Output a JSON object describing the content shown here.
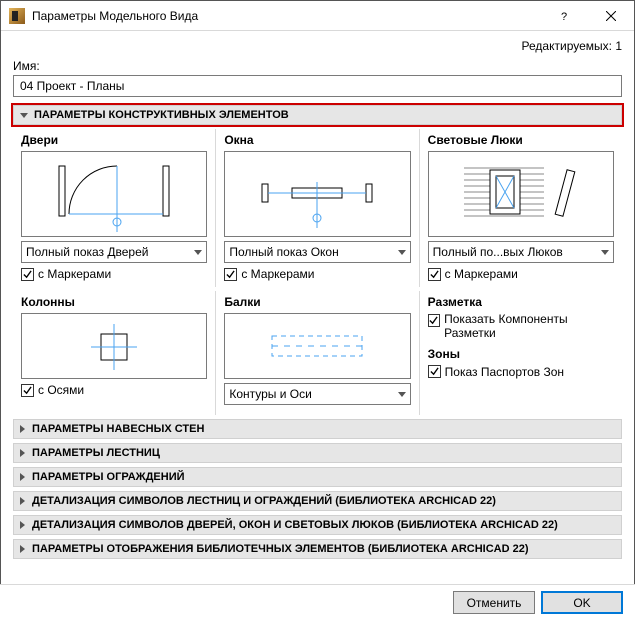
{
  "window": {
    "title": "Параметры Модельного Вида"
  },
  "editable_label": "Редактируемых: 1",
  "name_label": "Имя:",
  "name_value": "04 Проект - Планы",
  "sections": {
    "construct": "ПАРАМЕТРЫ КОНСТРУКТИВНЫХ ЭЛЕМЕНТОВ",
    "curtain": "ПАРАМЕТРЫ НАВЕСНЫХ СТЕН",
    "stair": "ПАРАМЕТРЫ ЛЕСТНИЦ",
    "railing": "ПАРАМЕТРЫ ОГРАЖДЕНИЙ",
    "stair_rail_lib": "ДЕТАЛИЗАЦИЯ СИМВОЛОВ ЛЕСТНИЦ И ОГРАЖДЕНИЙ (БИБЛИОТЕКА ARCHICAD 22)",
    "door_win_lib": "ДЕТАЛИЗАЦИЯ СИМВОЛОВ ДВЕРЕЙ, ОКОН И СВЕТОВЫХ ЛЮКОВ (БИБЛИОТЕКА ARCHICAD 22)",
    "lib_disp": "ПАРАМЕТРЫ ОТОБРАЖЕНИЯ БИБЛИОТЕЧНЫХ ЭЛЕМЕНТОВ (БИБЛИОТЕКА ARCHICAD 22)"
  },
  "doors": {
    "title": "Двери",
    "combo": "Полный показ Дверей",
    "check": "с Маркерами"
  },
  "windows": {
    "title": "Окна",
    "combo": "Полный показ Окон",
    "check": "с Маркерами"
  },
  "skylights": {
    "title": "Световые Люки",
    "combo": "Полный по...вых Люков",
    "check": "с Маркерами"
  },
  "columns": {
    "title": "Колонны",
    "check": "с Осями"
  },
  "beams": {
    "title": "Балки",
    "combo": "Контуры и Оси"
  },
  "markup": {
    "title": "Разметка",
    "check": "Показать Компоненты Разметки"
  },
  "zones": {
    "title": "Зоны",
    "check": "Показ Паспортов Зон"
  },
  "buttons": {
    "cancel": "Отменить",
    "ok": "OK"
  }
}
